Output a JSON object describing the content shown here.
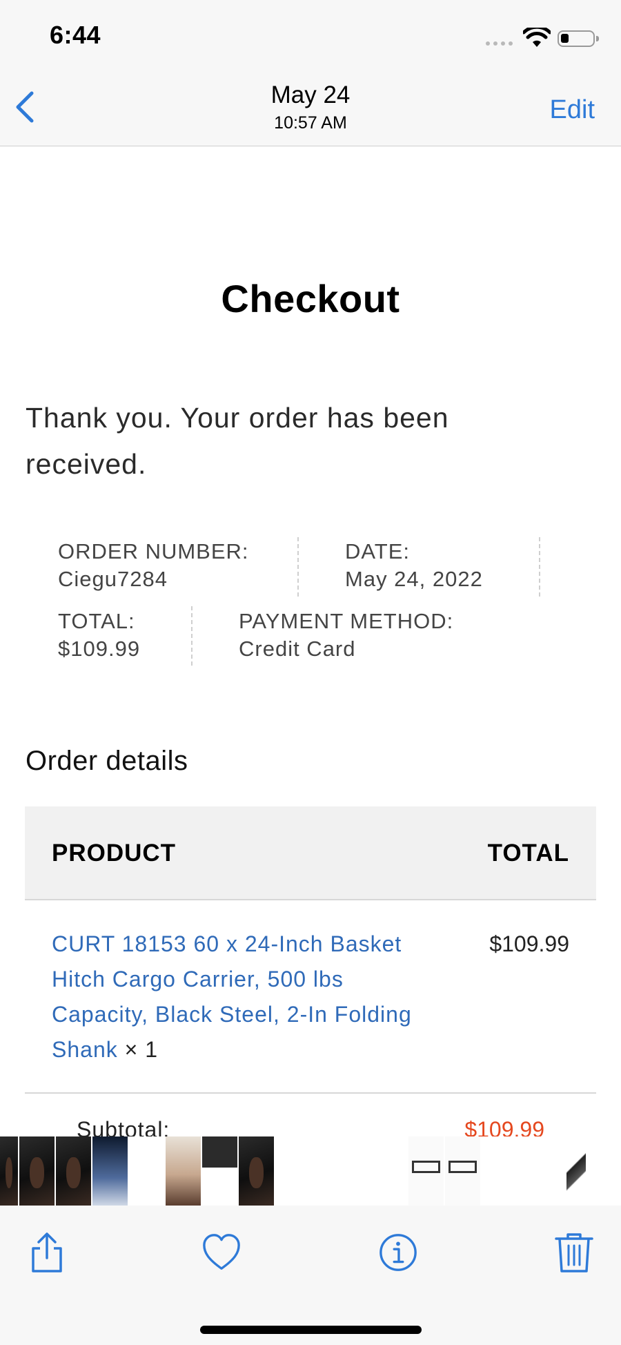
{
  "status_bar": {
    "time": "6:44"
  },
  "nav": {
    "title": "May 24",
    "subtitle": "10:57 AM",
    "edit_label": "Edit"
  },
  "page": {
    "title": "Checkout",
    "thank_you": "Thank you. Your order has been received."
  },
  "order_overview": {
    "order_number_label": "ORDER NUMBER:",
    "order_number": "Ciegu7284",
    "date_label": "DATE:",
    "date": "May 24, 2022",
    "total_label": "TOTAL:",
    "total": "$109.99",
    "payment_label": "PAYMENT METHOD:",
    "payment": "Credit Card"
  },
  "order_details": {
    "heading": "Order details",
    "columns": {
      "product": "PRODUCT",
      "total": "TOTAL"
    },
    "items": [
      {
        "name": "CURT 18153 60 x 24-Inch Basket Hitch Cargo Carrier, 500 lbs Capacity, Black Steel, 2-In Folding Shank",
        "qty": "× 1",
        "total": "$109.99"
      }
    ],
    "subtotal_label": "Subtotal:",
    "subtotal_value": "$109.99"
  },
  "thumbnails": [
    "dark",
    "dark",
    "dark",
    "blue",
    "doc",
    "photo",
    "red",
    "dark",
    "doc",
    "doc",
    "doc",
    "rack",
    "rack",
    "doc",
    "doc",
    "edge"
  ],
  "toolbar": {
    "icons": [
      "share-icon",
      "heart-icon",
      "info-icon",
      "trash-icon"
    ]
  },
  "colors": {
    "accent": "#2e7ad8",
    "link": "#2f6ab8",
    "price_highlight": "#e5481f"
  }
}
